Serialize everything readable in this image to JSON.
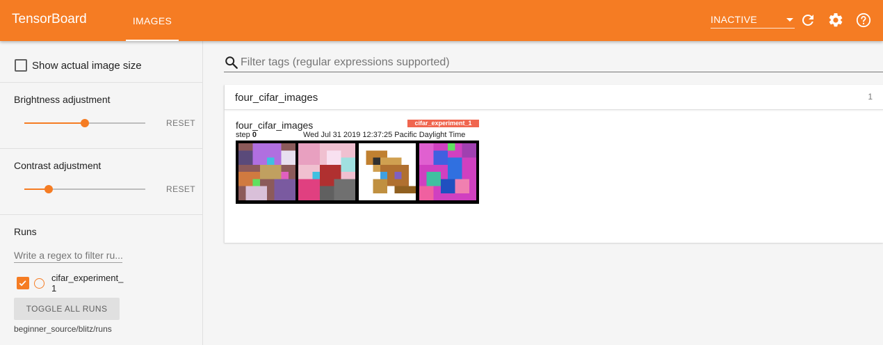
{
  "header": {
    "brand": "TensorBoard",
    "tab_images": "IMAGES",
    "status_select": "INACTIVE",
    "icons": [
      "refresh-icon",
      "gear-icon",
      "help-icon"
    ],
    "accent_color": "#f57c23"
  },
  "sidebar": {
    "show_actual_size_label": "Show actual image size",
    "show_actual_size_checked": false,
    "brightness": {
      "title": "Brightness adjustment",
      "reset_label": "RESET",
      "value_fraction": 0.5
    },
    "contrast": {
      "title": "Contrast adjustment",
      "reset_label": "RESET",
      "value_fraction": 0.2
    },
    "runs": {
      "title": "Runs",
      "filter_placeholder": "Write a regex to filter ru...",
      "items": [
        {
          "name": "cifar_experiment_1",
          "checked": true,
          "color": "#f57c23"
        }
      ],
      "toggle_all_label": "TOGGLE ALL RUNS",
      "logdir": "beginner_source/blitz/runs"
    }
  },
  "main": {
    "filter_placeholder": "Filter tags (regular expressions supported)",
    "card": {
      "title": "four_cifar_images",
      "count": "1",
      "image_panel": {
        "tag": "four_cifar_images",
        "run_label": "cifar_experiment_1",
        "run_color": "#f0664f",
        "step_prefix": "step",
        "step": "0",
        "wall_time": "Wed Jul 31 2019 12:37:25 Pacific Daylight Time",
        "thumbnails": [
          "mixed-pixel-image",
          "pink-pixel-image",
          "frog-image",
          "magenta-pixel-image"
        ]
      }
    }
  }
}
